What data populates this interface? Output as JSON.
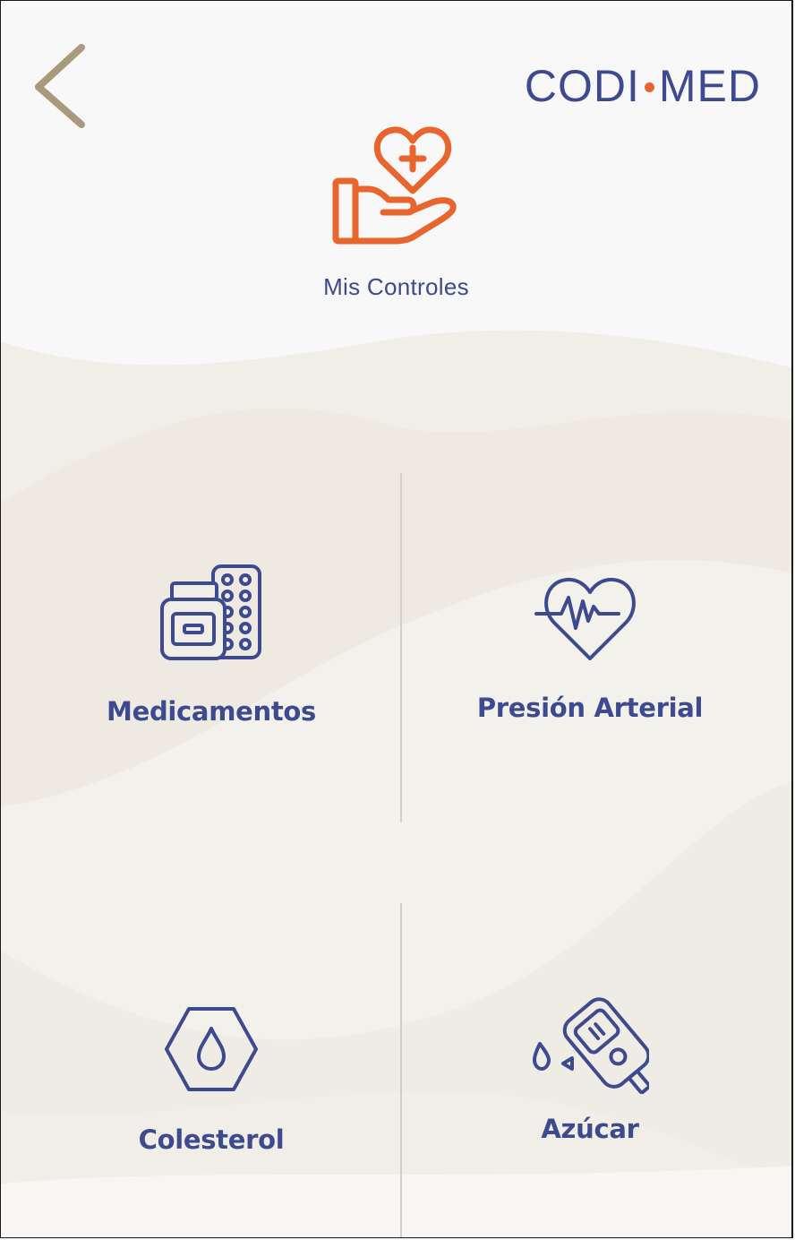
{
  "header": {
    "back_icon": "chevron-left-icon",
    "logo_left": "CODI",
    "logo_right": "MED"
  },
  "hero": {
    "icon": "heart-hand-icon",
    "title": "Mis Controles"
  },
  "tiles": [
    {
      "label": "Medicamentos",
      "icon": "medication-icon"
    },
    {
      "label": "Presión Arterial",
      "icon": "heartbeat-icon"
    },
    {
      "label": "Colesterol",
      "icon": "drop-hexagon-icon"
    },
    {
      "label": "Azúcar",
      "icon": "glucometer-icon"
    }
  ],
  "colors": {
    "primary": "#3d4a8f",
    "accent": "#e8652d",
    "back": "#a89a7a",
    "background": "#f8f8f8",
    "wave": "#efebe4"
  }
}
